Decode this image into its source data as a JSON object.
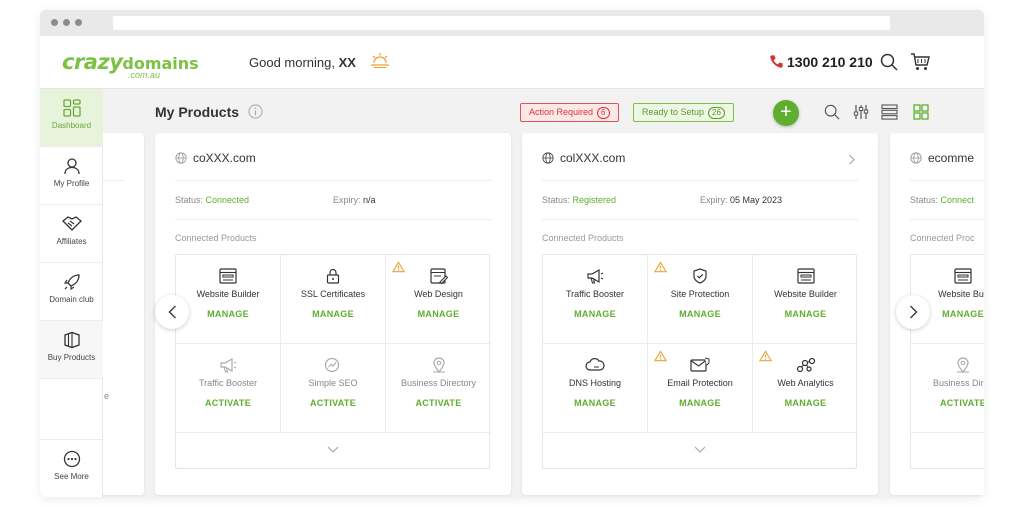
{
  "header": {
    "logo_main": "crazy",
    "logo_domains": "domains",
    "logo_suffix": ".com.au",
    "greeting": "Good morning, ",
    "user_name": "XX",
    "phone": "1300 210 210"
  },
  "sidebar": {
    "items": [
      {
        "label": "Dashboard",
        "icon": "dashboard-icon"
      },
      {
        "label": "My Profile",
        "icon": "user-icon"
      },
      {
        "label": "Affiliates",
        "icon": "handshake-icon"
      },
      {
        "label": "Domain club",
        "icon": "rocket-icon"
      },
      {
        "label": "Buy Products",
        "icon": "box-icon"
      }
    ],
    "see_more": "See More"
  },
  "subheader": {
    "title": "My Products",
    "action_required_label": "Action Required",
    "action_required_count": "6",
    "ready_label": "Ready to Setup",
    "ready_count": "26",
    "add_label": "+"
  },
  "colors": {
    "brand_green": "#7cc242",
    "action_green": "#5fae2e",
    "alert_red": "#d33333",
    "warning_orange": "#f0a030"
  },
  "cards": [
    {
      "domain": "coXXX.com",
      "status_label": "Status:",
      "status": "Connected",
      "expiry_label": "Expiry:",
      "expiry": "n/a",
      "connected_label": "Connected Products",
      "products": [
        {
          "name": "Website Builder",
          "action": "MANAGE",
          "icon": "website-icon",
          "warning": false,
          "muted": false
        },
        {
          "name": "SSL Certificates",
          "action": "MANAGE",
          "icon": "lock-icon",
          "warning": false,
          "muted": false
        },
        {
          "name": "Web Design",
          "action": "MANAGE",
          "icon": "design-icon",
          "warning": true,
          "muted": false
        },
        {
          "name": "Traffic Booster",
          "action": "ACTIVATE",
          "icon": "megaphone-icon",
          "warning": false,
          "muted": true
        },
        {
          "name": "Simple SEO",
          "action": "ACTIVATE",
          "icon": "seo-icon",
          "warning": false,
          "muted": true
        },
        {
          "name": "Business Directory",
          "action": "ACTIVATE",
          "icon": "location-icon",
          "warning": false,
          "muted": true
        }
      ]
    },
    {
      "domain": "colXXX.com",
      "status_label": "Status:",
      "status": "Registered",
      "expiry_label": "Expiry:",
      "expiry": "05 May 2023",
      "connected_label": "Connected Products",
      "products": [
        {
          "name": "Traffic Booster",
          "action": "MANAGE",
          "icon": "megaphone-icon",
          "warning": false,
          "muted": false
        },
        {
          "name": "Site Protection",
          "action": "MANAGE",
          "icon": "shield-icon",
          "warning": true,
          "muted": false
        },
        {
          "name": "Website Builder",
          "action": "MANAGE",
          "icon": "website-icon",
          "warning": false,
          "muted": false
        },
        {
          "name": "DNS Hosting",
          "action": "MANAGE",
          "icon": "cloud-icon",
          "warning": false,
          "muted": false
        },
        {
          "name": "Email Protection",
          "action": "MANAGE",
          "icon": "email-icon",
          "warning": true,
          "muted": false
        },
        {
          "name": "Web Analytics",
          "action": "MANAGE",
          "icon": "analytics-icon",
          "warning": true,
          "muted": false
        }
      ]
    },
    {
      "domain": "ecomme",
      "status_label": "Status:",
      "status": "Connect",
      "connected_label": "Connected Proc",
      "products": [
        {
          "name": "Website Buil",
          "action": "MANAGE",
          "icon": "website-icon"
        },
        {
          "name": "Business Direc",
          "action": "ACTIVATE",
          "icon": "location-icon"
        }
      ]
    }
  ],
  "left_card_fragment": "e"
}
